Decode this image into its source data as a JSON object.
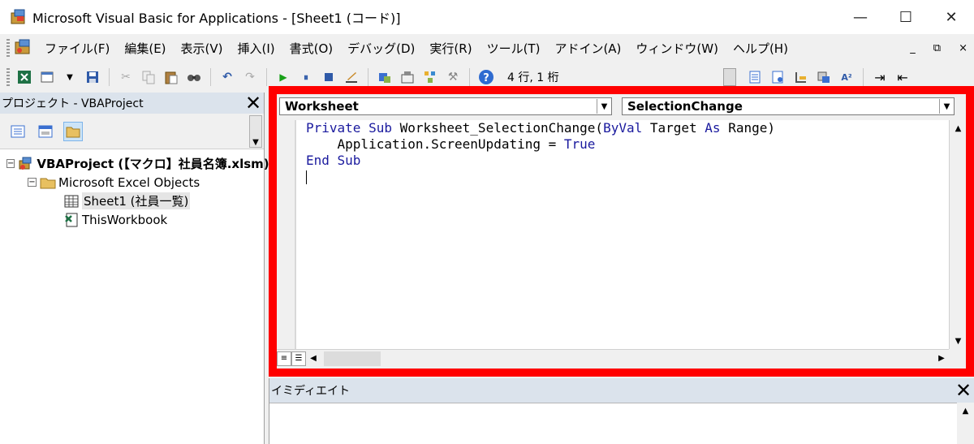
{
  "window": {
    "title": "Microsoft Visual Basic for Applications - [Sheet1 (コード)]",
    "minimize": "—",
    "maximize": "☐",
    "close": "✕"
  },
  "menu": {
    "items": [
      "ファイル(F)",
      "編集(E)",
      "表示(V)",
      "挿入(I)",
      "書式(O)",
      "デバッグ(D)",
      "実行(R)",
      "ツール(T)",
      "アドイン(A)",
      "ウィンドウ(W)",
      "ヘルプ(H)"
    ],
    "doc_min": "_",
    "doc_restore": "⧉",
    "doc_close": "×"
  },
  "toolbar": {
    "position": "4 行, 1 桁"
  },
  "project": {
    "title": "プロジェクト - VBAProject",
    "close": "✕",
    "tree": {
      "root": "VBAProject (【マクロ】社員名簿.xlsm)",
      "folder": "Microsoft Excel Objects",
      "sheet1": "Sheet1 (社員一覧)",
      "workbook": "ThisWorkbook"
    }
  },
  "code": {
    "object_select": "Worksheet",
    "procedure_select": "SelectionChange",
    "lines": {
      "l1_kw1": "Private Sub",
      "l1_name": " Worksheet_SelectionChange(",
      "l1_kw2": "ByVal",
      "l1_target": " Target ",
      "l1_kw3": "As",
      "l1_type": " Range)",
      "l2_text": "    Application.ScreenUpdating = ",
      "l2_kw": "True",
      "l3_kw": "End Sub"
    }
  },
  "immediate": {
    "title": "イミディエイト",
    "close": "✕"
  },
  "colors": {
    "highlight_frame": "#ff0000",
    "keyword": "#1a1a9e",
    "panel_header": "#dbe3ec"
  }
}
